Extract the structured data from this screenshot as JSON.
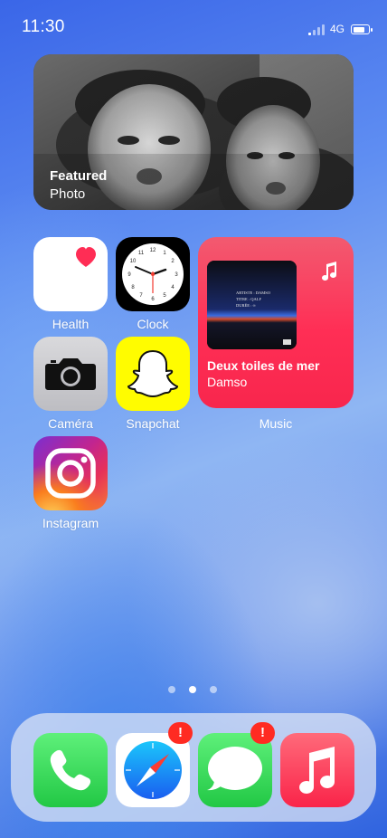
{
  "status_bar": {
    "time": "11:30",
    "network": "4G"
  },
  "photo_widget": {
    "line1": "Featured",
    "line2": "Photo"
  },
  "apps": {
    "health": "Health",
    "clock": "Clock",
    "camera": "Caméra",
    "snapchat": "Snapchat",
    "instagram": "Instagram",
    "music": "Music"
  },
  "music_widget": {
    "song": "Deux toiles de mer",
    "artist": "Damso",
    "album_art_text": [
      "ARTISTE : DAMSO",
      "TITRE : QALF",
      "DURÉE : ∞"
    ]
  },
  "page_dots": {
    "count": 3,
    "active": 1
  },
  "dock": {
    "apps": [
      "phone",
      "safari",
      "messages",
      "music"
    ],
    "safari_badge": "!",
    "messages_badge": "!"
  },
  "colors": {
    "music_red": "#ff2e55",
    "phone_green": "#2bd04f",
    "badge_red": "#ff2b22",
    "snapchat_yellow": "#fffc00"
  }
}
